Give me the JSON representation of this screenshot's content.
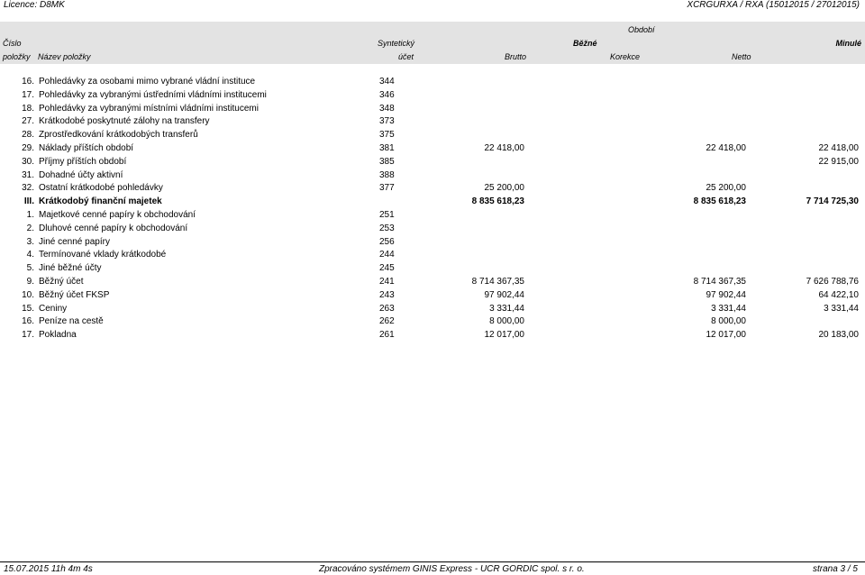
{
  "top": {
    "licence": "Licence: D8MK",
    "report_code": "XCRGURXA / RXA  (15012015 / 27012015)"
  },
  "header": {
    "obdobi": "Období",
    "cislo": "Číslo",
    "polozky": "položky",
    "nazev": "Název položky",
    "synteticky": "Syntetický",
    "ucet": "účet",
    "bezne": "Běžné",
    "minule": "Minulé",
    "brutto": "Brutto",
    "korekce": "Korekce",
    "netto": "Netto"
  },
  "rows": [
    {
      "num": "16.",
      "name": "Pohledávky za osobami mimo vybrané vládní instituce",
      "syn": "344",
      "brutto": "",
      "netto": "",
      "minule": ""
    },
    {
      "num": "17.",
      "name": "Pohledávky za vybranými ústředními vládními institucemi",
      "syn": "346",
      "brutto": "",
      "netto": "",
      "minule": ""
    },
    {
      "num": "18.",
      "name": "Pohledávky za vybranými místními vládními institucemi",
      "syn": "348",
      "brutto": "",
      "netto": "",
      "minule": ""
    },
    {
      "num": "27.",
      "name": "Krátkodobé poskytnuté zálohy na transfery",
      "syn": "373",
      "brutto": "",
      "netto": "",
      "minule": ""
    },
    {
      "num": "28.",
      "name": "Zprostředkování krátkodobých transferů",
      "syn": "375",
      "brutto": "",
      "netto": "",
      "minule": ""
    },
    {
      "num": "29.",
      "name": "Náklady příštích období",
      "syn": "381",
      "brutto": "22 418,00",
      "netto": "22 418,00",
      "minule": "22 418,00"
    },
    {
      "num": "30.",
      "name": "Příjmy příštích období",
      "syn": "385",
      "brutto": "",
      "netto": "",
      "minule": "22 915,00"
    },
    {
      "num": "31.",
      "name": "Dohadné účty aktivní",
      "syn": "388",
      "brutto": "",
      "netto": "",
      "minule": ""
    },
    {
      "num": "32.",
      "name": "Ostatní krátkodobé pohledávky",
      "syn": "377",
      "brutto": "25 200,00",
      "netto": "25 200,00",
      "minule": ""
    },
    {
      "num": "III.",
      "name": "Krátkodobý finanční majetek",
      "syn": "",
      "brutto": "8 835 618,23",
      "netto": "8 835 618,23",
      "minule": "7 714 725,30",
      "bold": true
    },
    {
      "num": "1.",
      "name": "Majetkové cenné papíry k obchodování",
      "syn": "251",
      "brutto": "",
      "netto": "",
      "minule": ""
    },
    {
      "num": "2.",
      "name": "Dluhové cenné papíry k obchodování",
      "syn": "253",
      "brutto": "",
      "netto": "",
      "minule": ""
    },
    {
      "num": "3.",
      "name": "Jiné cenné papíry",
      "syn": "256",
      "brutto": "",
      "netto": "",
      "minule": ""
    },
    {
      "num": "4.",
      "name": "Termínované vklady krátkodobé",
      "syn": "244",
      "brutto": "",
      "netto": "",
      "minule": ""
    },
    {
      "num": "5.",
      "name": "Jiné běžné účty",
      "syn": "245",
      "brutto": "",
      "netto": "",
      "minule": ""
    },
    {
      "num": "9.",
      "name": "Běžný účet",
      "syn": "241",
      "brutto": "8 714 367,35",
      "netto": "8 714 367,35",
      "minule": "7 626 788,76"
    },
    {
      "num": "10.",
      "name": "Běžný účet FKSP",
      "syn": "243",
      "brutto": "97 902,44",
      "netto": "97 902,44",
      "minule": "64 422,10"
    },
    {
      "num": "15.",
      "name": "Ceniny",
      "syn": "263",
      "brutto": "3 331,44",
      "netto": "3 331,44",
      "minule": "3 331,44"
    },
    {
      "num": "16.",
      "name": "Peníze na cestě",
      "syn": "262",
      "brutto": "8 000,00",
      "netto": "8 000,00",
      "minule": ""
    },
    {
      "num": "17.",
      "name": "Pokladna",
      "syn": "261",
      "brutto": "12 017,00",
      "netto": "12 017,00",
      "minule": "20 183,00"
    }
  ],
  "footer": {
    "datetime": "15.07.2015 11h 4m 4s",
    "system": "Zpracováno systémem GINIS Express - UCR GORDIC spol. s r. o.",
    "page": "strana 3 / 5"
  }
}
